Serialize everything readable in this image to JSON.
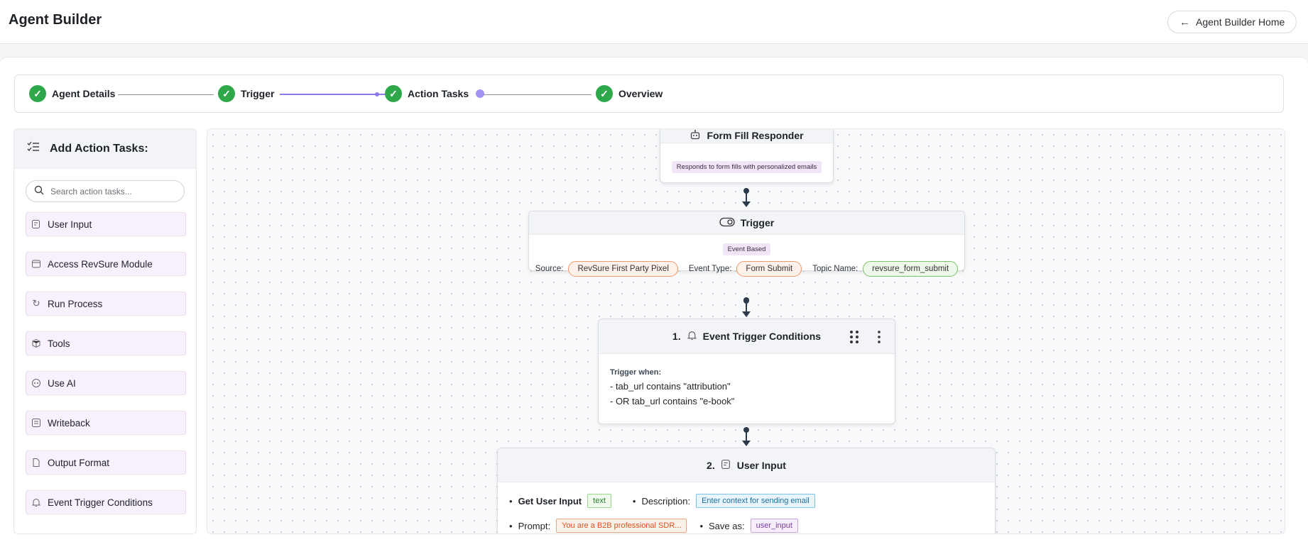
{
  "header": {
    "title": "Agent Builder",
    "home_button": "Agent Builder Home"
  },
  "stepper": {
    "steps": [
      {
        "label": "Agent Details",
        "status": "done"
      },
      {
        "label": "Trigger",
        "status": "done"
      },
      {
        "label": "Action Tasks",
        "status": "current"
      },
      {
        "label": "Overview",
        "status": "done"
      }
    ]
  },
  "sidebar": {
    "title": "Add Action Tasks:",
    "search_placeholder": "Search action tasks...",
    "items": [
      {
        "label": "User Input",
        "icon": "user-input-icon"
      },
      {
        "label": "Access RevSure Module",
        "icon": "module-icon"
      },
      {
        "label": "Run Process",
        "icon": "refresh-icon"
      },
      {
        "label": "Tools",
        "icon": "tools-icon"
      },
      {
        "label": "Use AI",
        "icon": "ai-icon"
      },
      {
        "label": "Writeback",
        "icon": "writeback-icon"
      },
      {
        "label": "Output Format",
        "icon": "output-format-icon"
      },
      {
        "label": "Event Trigger Conditions",
        "icon": "bell-icon"
      }
    ]
  },
  "canvas": {
    "agent_node": {
      "title": "Form Fill Responder",
      "description": "Responds to form fills with personalized emails"
    },
    "trigger_node": {
      "title": "Trigger",
      "type": "Event Based",
      "source_label": "Source:",
      "source_value": "RevSure First Party Pixel",
      "event_label": "Event Type:",
      "event_value": "Form Submit",
      "topic_label": "Topic Name:",
      "topic_value": "revsure_form_submit"
    },
    "conditions_node": {
      "number": "1.",
      "title": "Event Trigger Conditions",
      "trigger_when": "Trigger when:",
      "line1": "- tab_url contains \"attribution\"",
      "line2": "- OR tab_url contains \"e-book\""
    },
    "user_input_node": {
      "number": "2.",
      "title": "User Input",
      "get_label": "Get User Input",
      "type_tag": "text",
      "description_label": "Description:",
      "description_value": "Enter context for sending email",
      "prompt_label": "Prompt:",
      "prompt_value": "You are a B2B professional SDR...",
      "save_label": "Save as:",
      "save_value": "user_input"
    }
  }
}
